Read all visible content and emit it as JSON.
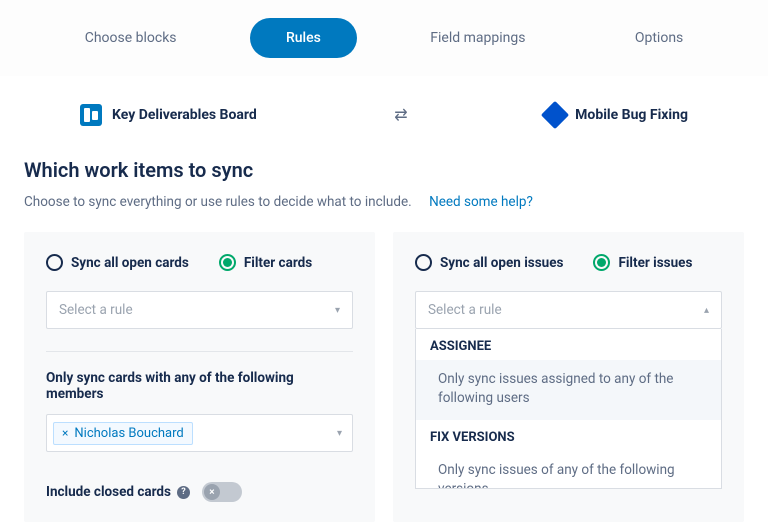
{
  "tabs": {
    "choose_blocks": "Choose blocks",
    "rules": "Rules",
    "field_mappings": "Field mappings",
    "options": "Options"
  },
  "connectors": {
    "left": "Key Deliverables Board",
    "right": "Mobile Bug Fixing"
  },
  "heading": "Which work items to sync",
  "subtitle": "Choose to sync everything or use rules to decide what to include.",
  "help_link": "Need some help?",
  "left_panel": {
    "radio_all": "Sync all open cards",
    "radio_filter": "Filter cards",
    "select_placeholder": "Select a rule",
    "member_label": "Only sync cards with any of the following members",
    "member_tag": "Nicholas Bouchard",
    "toggle_label": "Include closed cards"
  },
  "right_panel": {
    "radio_all": "Sync all open issues",
    "radio_filter": "Filter issues",
    "select_placeholder": "Select a rule",
    "dd_group1": "ASSIGNEE",
    "dd_item1": "Only sync issues assigned to any of the following users",
    "dd_group2": "FIX VERSIONS",
    "dd_item2": "Only sync issues of any of the following versions"
  }
}
